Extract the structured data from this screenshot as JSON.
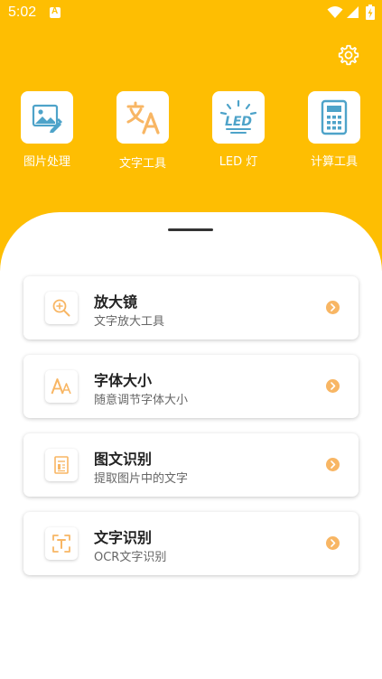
{
  "status_bar": {
    "time": "5:02",
    "notification_letter": "A",
    "icons": [
      "notification-icon",
      "wifi-icon",
      "signal-icon",
      "battery-icon"
    ]
  },
  "colors": {
    "accent": "#FEBE02",
    "icon_orange": "#F8B664",
    "calc_blue": "#4EA3C9",
    "text_dark": "#222222",
    "text_sub": "#666666"
  },
  "tools": [
    {
      "label": "图片处理",
      "icon": "image-edit-icon"
    },
    {
      "label": "文字工具",
      "icon": "translate-icon"
    },
    {
      "label": "LED 灯",
      "icon": "led-icon",
      "icon_text": "LED"
    },
    {
      "label": "计算工具",
      "icon": "calculator-icon"
    }
  ],
  "cards": [
    {
      "title": "放大镜",
      "subtitle": "文字放大工具",
      "icon": "magnifier-icon"
    },
    {
      "title": "字体大小",
      "subtitle": "随意调节字体大小",
      "icon": "font-size-icon"
    },
    {
      "title": "图文识别",
      "subtitle": "提取图片中的文字",
      "icon": "document-scan-icon"
    },
    {
      "title": "文字识别",
      "subtitle": "OCR文字识别",
      "icon": "text-scan-icon"
    }
  ]
}
